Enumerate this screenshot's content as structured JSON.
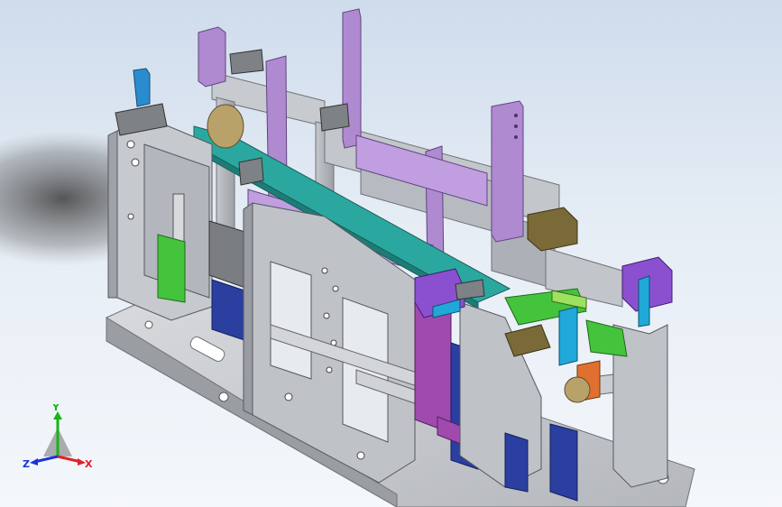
{
  "viewport": {
    "triad": {
      "x_label": "X",
      "y_label": "Y",
      "z_label": "Z",
      "x_color": "#e0202a",
      "y_color": "#18b418",
      "z_color": "#1a34d8"
    }
  },
  "colors": {
    "frame": "#a9acb2",
    "frame_light": "#c8cbd0",
    "frame_dark": "#7e8186",
    "purple": "#b08ad0",
    "purple_dark": "#8d69b0",
    "teal": "#2aa8a0",
    "teal_dark": "#1c7d77",
    "blue": "#2a3fa0",
    "green": "#44c43c",
    "olive": "#7a6a38",
    "magenta": "#a04ab0",
    "orange": "#e07030",
    "cyan": "#20a8d8"
  }
}
